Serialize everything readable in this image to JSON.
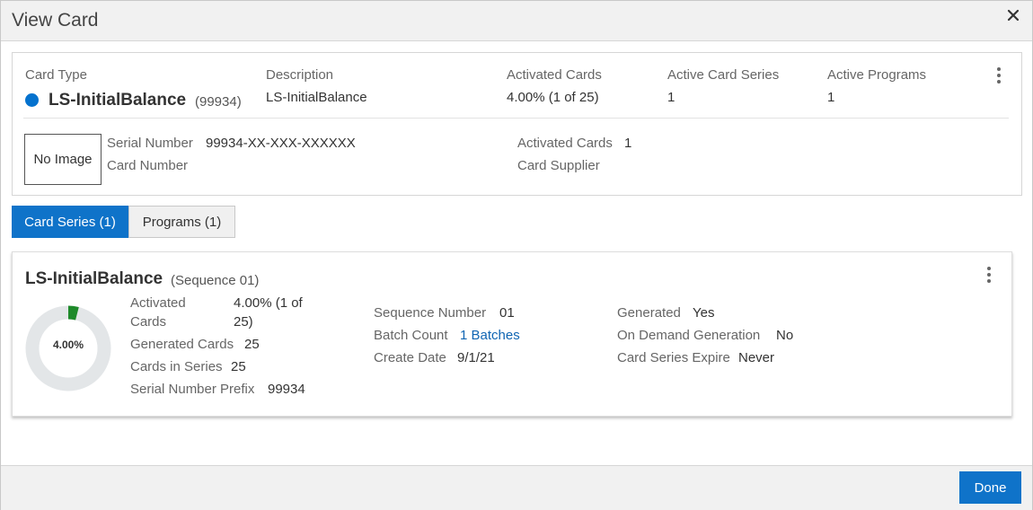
{
  "dialog": {
    "title": "View Card",
    "close_icon": "close-icon"
  },
  "summary": {
    "card_type_label": "Card Type",
    "card_name": "LS-InitialBalance",
    "card_code": "(99934)",
    "status_color": "#0572ce",
    "description_label": "Description",
    "description_value": "LS-InitialBalance",
    "activated_cards_label": "Activated Cards",
    "activated_cards_value": "4.00% (1 of 25)",
    "active_card_series_label": "Active Card Series",
    "active_card_series_value": "1",
    "active_programs_label": "Active Programs",
    "active_programs_value": "1",
    "no_image_text": "No Image",
    "serial_number_label": "Serial Number",
    "serial_number_value": "99934-XX-XXX-XXXXXX",
    "card_number_label": "Card Number",
    "card_number_value": "",
    "activated_cards_label_2": "Activated Cards",
    "activated_cards_value_2": "1",
    "card_supplier_label": "Card Supplier",
    "card_supplier_value": ""
  },
  "tabs": [
    {
      "label": "Card Series (1)",
      "active": true
    },
    {
      "label": "Programs (1)",
      "active": false
    }
  ],
  "series": {
    "name": "LS-InitialBalance",
    "sequence": "(Sequence 01)",
    "donut_percent": 4.0,
    "donut_label": "4.00%",
    "donut_color": "#1e8a2a",
    "donut_track_color": "#e3e6e8",
    "activated_cards_label_line1": "Activated",
    "activated_cards_label_line2": "Cards",
    "activated_cards_value_line1": "4.00% (1 of",
    "activated_cards_value_line2": "25)",
    "generated_cards_label": "Generated Cards",
    "generated_cards_value": "25",
    "cards_in_series_label": "Cards in Series",
    "cards_in_series_value": "25",
    "serial_prefix_label": "Serial Number Prefix",
    "serial_prefix_value": "99934",
    "sequence_number_label": "Sequence Number",
    "sequence_number_value": "01",
    "batch_count_label": "Batch Count",
    "batch_count_value": "1 Batches",
    "create_date_label": "Create Date",
    "create_date_value": "9/1/21",
    "generated_label": "Generated",
    "generated_value": "Yes",
    "on_demand_label": "On Demand Generation",
    "on_demand_value": "No",
    "expire_label": "Card Series Expire",
    "expire_value": "Never"
  },
  "footer": {
    "done_label": "Done"
  }
}
